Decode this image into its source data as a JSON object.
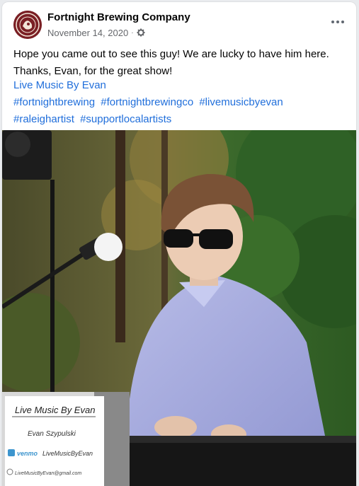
{
  "post": {
    "page_name": "Fortnight Brewing Company",
    "date": "November 14, 2020",
    "separator": "·",
    "audience_icon": "gear-icon",
    "more_icon": "more-options-icon",
    "text_line_1": "Hope you came out to see this guy! We are lucky to have him here.",
    "text_line_2": "Thanks, Evan, for the great show!",
    "link_text": "Live Music By Evan",
    "hashtags": [
      "#fortnightbrewing",
      "#fortnightbrewingco",
      "#livemusicbyevan",
      "#raleighartist",
      "#supportlocalartists"
    ]
  },
  "photo": {
    "sign_title": "Live Music By Evan",
    "sign_name": "Evan Szypulski",
    "sign_venmo_brand": "venmo",
    "sign_venmo_handle": "LiveMusicByEvan",
    "sign_email": "LiveMusicByEvan@gmail.com"
  },
  "colors": {
    "link": "#216fdb",
    "text": "#050505",
    "meta": "#65676b",
    "avatar": "#7a1f24"
  }
}
